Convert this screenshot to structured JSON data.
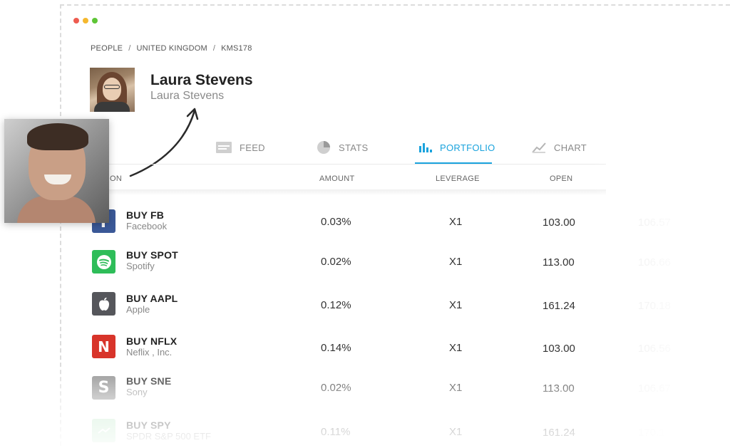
{
  "window_dots": {
    "red": "#ee5b4f",
    "yellow": "#f5b82e",
    "green": "#5ec536"
  },
  "breadcrumb": {
    "items": [
      "PEOPLE",
      "UNITED KINGDOM",
      "KMS178"
    ],
    "separator": "/"
  },
  "profile": {
    "name": "Laura Stevens",
    "username": "Laura Stevens"
  },
  "tabs": [
    {
      "label": "FEED",
      "icon": "feed-icon"
    },
    {
      "label": "STATS",
      "icon": "pie-chart-icon"
    },
    {
      "label": "PORTFOLIO",
      "icon": "bar-chart-icon",
      "active": true
    },
    {
      "label": "CHART",
      "icon": "line-chart-icon"
    }
  ],
  "accent_color": "#1aa3dd",
  "columns": {
    "action": "ON",
    "amount": "AMOUNT",
    "leverage": "LEVERAGE",
    "open": "OPEN"
  },
  "rows": [
    {
      "title": "BUY FB",
      "subtitle": "Facebook",
      "amount": "0.03%",
      "leverage": "X1",
      "open": "103.00",
      "close": "106.57",
      "logo": "f",
      "logo_color": "#3b5998"
    },
    {
      "title": "BUY SPOT",
      "subtitle": "Spotify",
      "amount": "0.02%",
      "leverage": "X1",
      "open": "113.00",
      "close": "106.66",
      "logo": "spotify-icon",
      "logo_color": "#2ebd59"
    },
    {
      "title": "BUY AAPL",
      "subtitle": "Apple",
      "amount": "0.12%",
      "leverage": "X1",
      "open": "161.24",
      "close": "170.18",
      "logo": "apple-icon",
      "logo_color": "#55565b"
    },
    {
      "title": "BUY NFLX",
      "subtitle": "Neflix , Inc.",
      "amount": "0.14%",
      "leverage": "X1",
      "open": "103.00",
      "close": "106.56",
      "logo": "N",
      "logo_color": "#d8342a"
    },
    {
      "title": "BUY SNE",
      "subtitle": "Sony",
      "amount": "0.02%",
      "leverage": "X1",
      "open": "113.00",
      "close": "106.67",
      "logo": "S",
      "logo_color": "#8e8e8e"
    },
    {
      "title": "BUY SPY",
      "subtitle": "SPDR S&P 500 ETF",
      "amount": "0.11%",
      "leverage": "X1",
      "open": "161.24",
      "close": "170.1",
      "logo": "spy-icon",
      "logo_color": "#bfe8c8"
    }
  ]
}
